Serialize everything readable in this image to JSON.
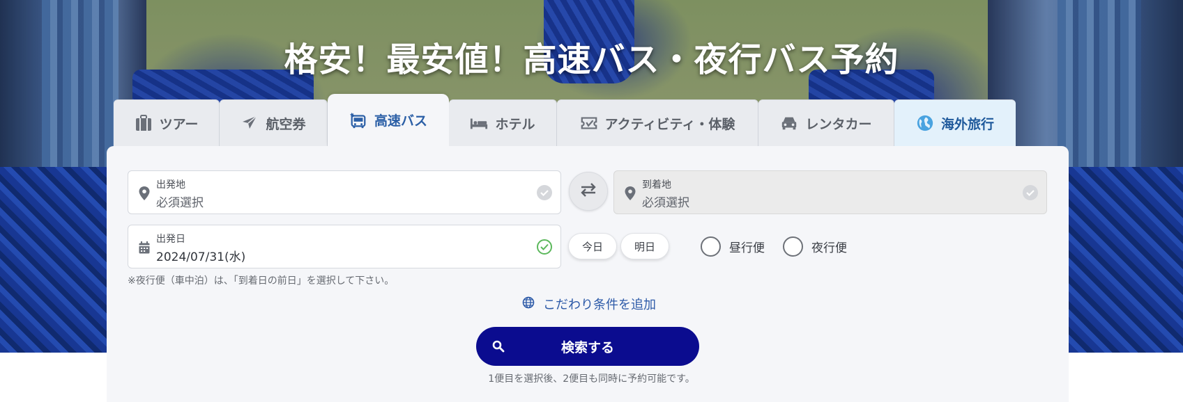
{
  "hero": {
    "title": "格安！最安値！高速バス・夜行バス予約"
  },
  "tabs": [
    {
      "label": "ツアー",
      "icon": "suitcase-icon"
    },
    {
      "label": "航空券",
      "icon": "airplane-icon"
    },
    {
      "label": "高速バス",
      "icon": "bus-icon"
    },
    {
      "label": "ホテル",
      "icon": "bed-icon"
    },
    {
      "label": "アクティビティ・体験",
      "icon": "ticket-icon"
    },
    {
      "label": "レンタカー",
      "icon": "car-icon"
    },
    {
      "label": "海外旅行",
      "icon": "globe-icon"
    }
  ],
  "active_tab": "高速バス",
  "form": {
    "departure": {
      "label": "出発地",
      "value": "必須選択"
    },
    "arrival": {
      "label": "到着地",
      "value": "必須選択"
    },
    "date": {
      "label": "出発日",
      "value": "2024/07/31(水)"
    },
    "today_label": "今日",
    "tomorrow_label": "明日",
    "day_bus_label": "昼行便",
    "night_bus_label": "夜行便",
    "night_note": "※夜行便（車中泊）は、「到着日の前日」を選択して下さい。",
    "add_conditions_label": "こだわり条件を追加",
    "search_label": "検索する",
    "search_note": "1便目を選択後、2便目も同時に予約可能です。"
  },
  "colors": {
    "accent": "#2b5fa6",
    "search_button": "#0b0c8f",
    "check_green": "#5cb85c",
    "overseas_tab_bg": "#e3f1fb"
  }
}
